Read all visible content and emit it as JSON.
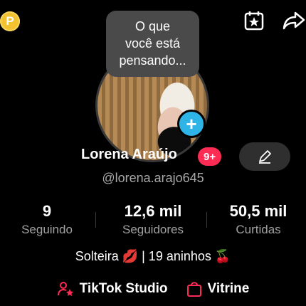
{
  "coin": {
    "label": "P"
  },
  "bubble": {
    "line1": "O que",
    "line2": "você está",
    "line3": "pensando..."
  },
  "profile": {
    "name": "Lorena Araújo",
    "notifications": "9+",
    "handle": "@lorena.arajo645",
    "bio": "Solteira 💋 | 19 aninhos 🍒"
  },
  "stats": [
    {
      "value": "9",
      "label": "Seguindo"
    },
    {
      "value": "12,6 mil",
      "label": "Seguidores"
    },
    {
      "value": "50,5 mil",
      "label": "Curtidas"
    }
  ],
  "links": {
    "studio": "TikTok Studio",
    "vitrine": "Vitrine"
  },
  "icons": {
    "coin": "coin-icon",
    "calendar": "calendar-star-icon",
    "share": "share-icon",
    "add": "plus-icon",
    "edit": "pencil-icon",
    "studio": "user-star-icon",
    "vitrine": "shopping-bag-icon"
  },
  "colors": {
    "background": "#000000",
    "accent_pink": "#fe2c55",
    "add_blue": "#2fb4e8",
    "coin_yellow": "#f2c230"
  }
}
